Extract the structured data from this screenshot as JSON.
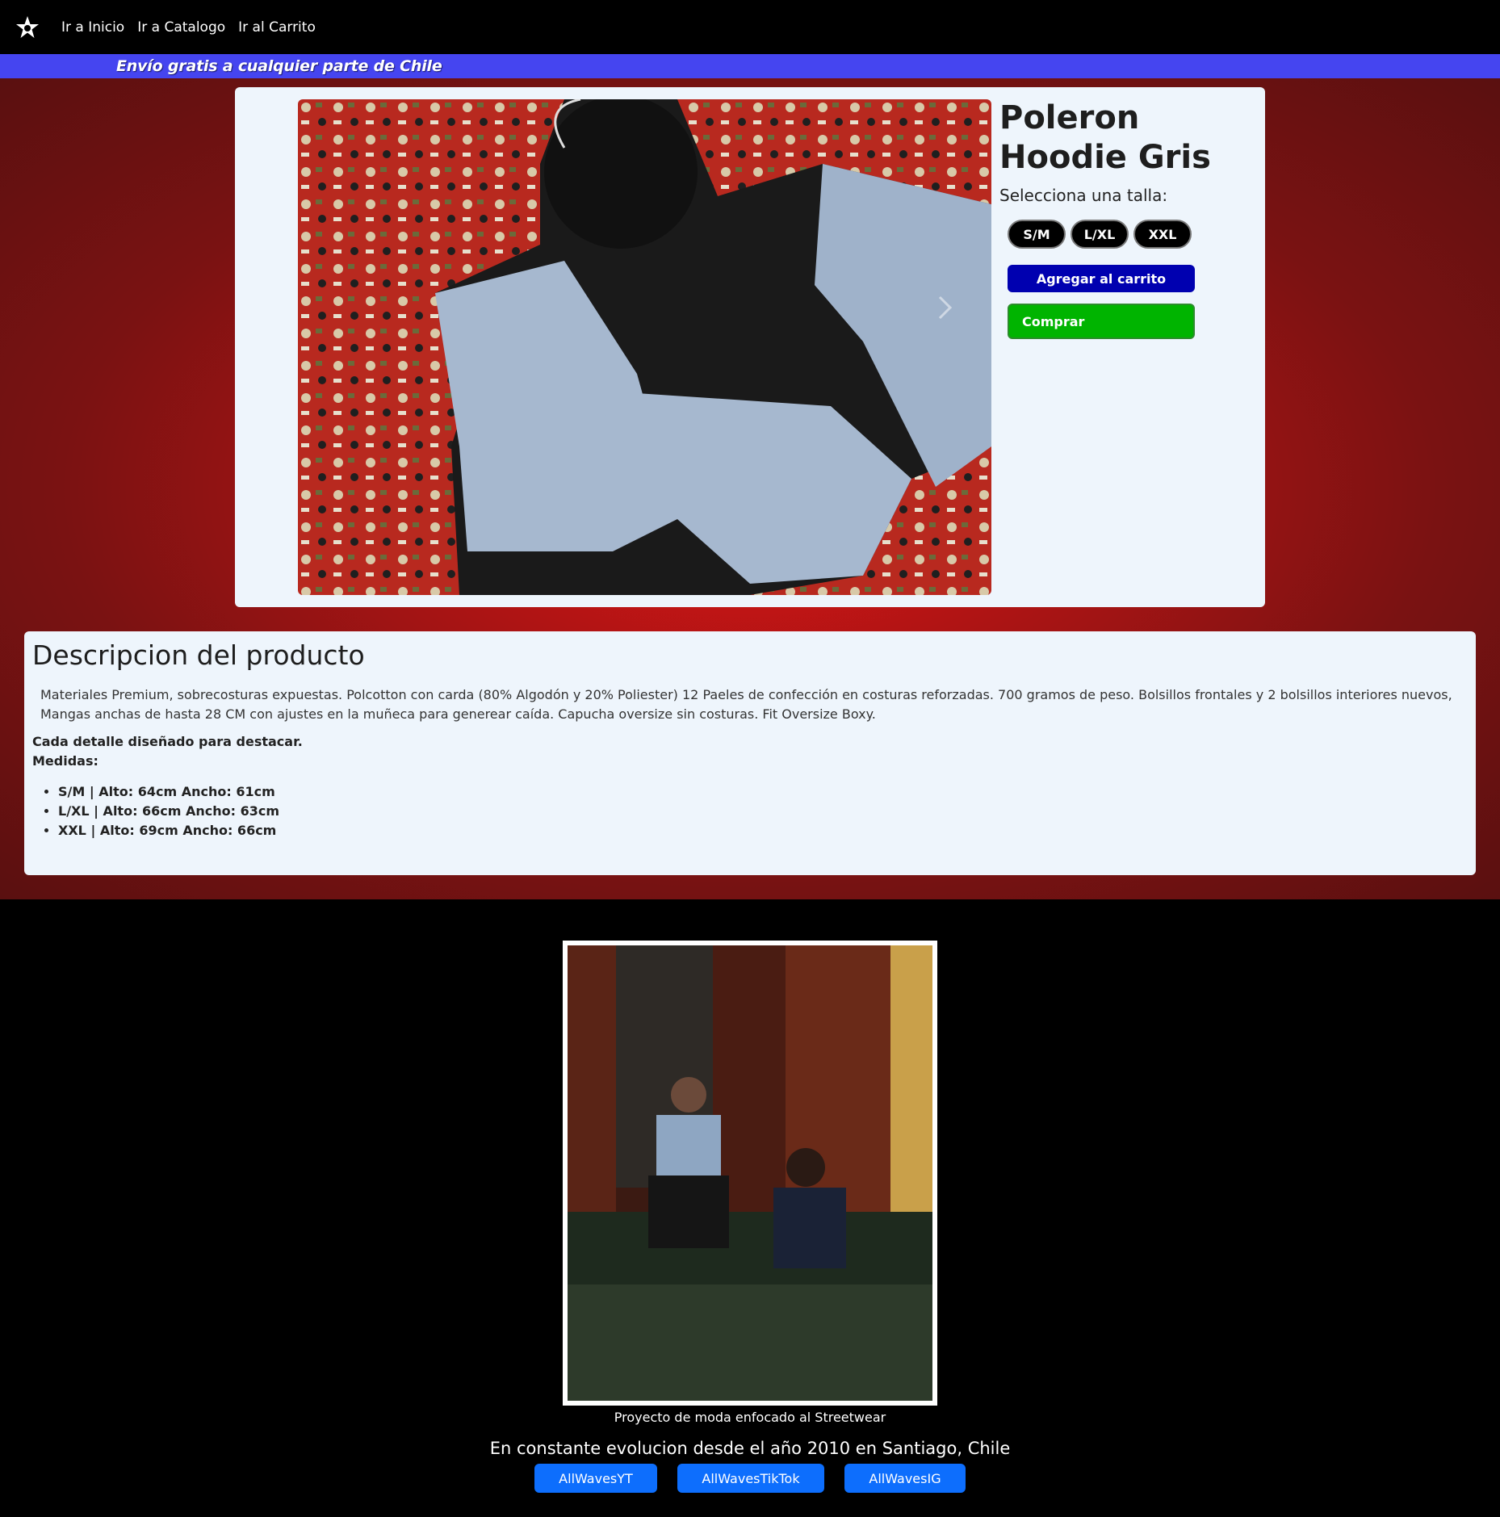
{
  "nav": {
    "links": [
      "Ir a Inicio",
      "Ir a Catalogo",
      "Ir al Carrito"
    ]
  },
  "promo": {
    "text": "Envío gratis a cualquier parte de Chile"
  },
  "product": {
    "title": "Poleron Hoodie Gris",
    "size_label": "Selecciona una talla:",
    "sizes": [
      "S/M",
      "L/XL",
      "XXL"
    ],
    "add_to_cart": "Agregar al carrito",
    "buy": "Comprar"
  },
  "description": {
    "title": "Descripcion del producto",
    "text": "Materiales Premium, sobrecosturas expuestas. Polcotton con carda (80% Algodón y 20% Poliester) 12 Paeles de confección en costuras reforzadas. 700 gramos de peso. Bolsillos frontales y 2 bolsillos interiores nuevos, Mangas anchas de hasta 28 CM con ajustes en la muñeca para generear caída. Capucha oversize sin costuras. Fit Oversize Boxy.",
    "highlight": "Cada detalle diseñado para destacar.",
    "measures_label": "Medidas:",
    "measures": [
      "S/M | Alto: 64cm Ancho: 61cm",
      "L/XL | Alto: 66cm Ancho: 63cm",
      "XXL | Alto: 69cm Ancho: 66cm"
    ]
  },
  "footer": {
    "caption": "Proyecto de moda enfocado al Streetwear",
    "tagline": "En constante evolucion desde el año 2010 en Santiago, Chile",
    "social": [
      "AllWavesYT",
      "AllWavesTikTok",
      "AllWavesIG"
    ]
  },
  "colors": {
    "promo_bar": "#4545f0",
    "add_to_cart": "#0000b0",
    "buy": "#00b400",
    "social": "#0d6efd"
  },
  "icons": {
    "logo": "star-logo-icon",
    "carousel_next": "chevron-right-icon"
  }
}
